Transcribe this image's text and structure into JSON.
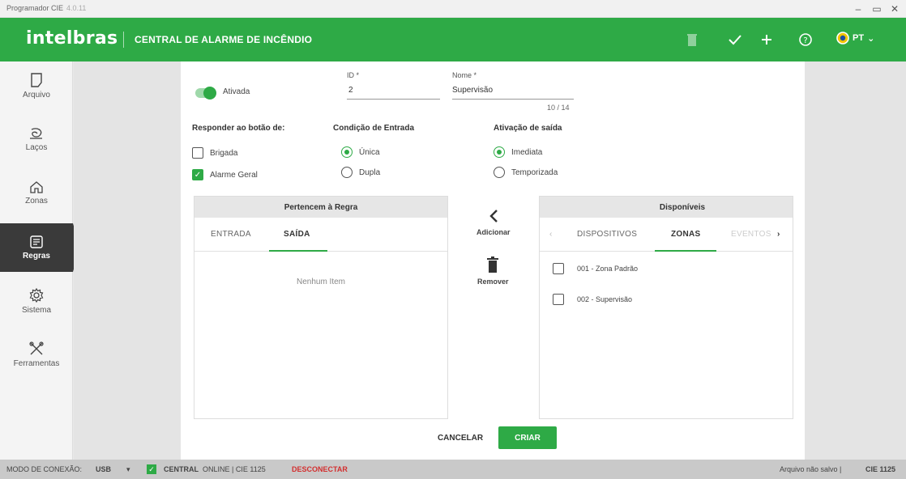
{
  "window": {
    "title": "Programador CIE",
    "version": "4.0.11"
  },
  "header": {
    "brand": "intelbras",
    "title": "CENTRAL DE ALARME DE INCÊNDIO",
    "lang": "PT"
  },
  "sidebar": {
    "items": [
      {
        "label": "Arquivo",
        "icon": "file-icon"
      },
      {
        "label": "Laços",
        "icon": "loop-icon"
      },
      {
        "label": "Zonas",
        "icon": "home-icon"
      },
      {
        "label": "Regras",
        "icon": "rules-icon",
        "active": true
      },
      {
        "label": "Sistema",
        "icon": "gear-icon"
      },
      {
        "label": "Ferramentas",
        "icon": "tools-icon"
      }
    ]
  },
  "form": {
    "toggle_label": "Ativada",
    "id_label": "ID *",
    "id_value": "2",
    "name_label": "Nome *",
    "name_value": "Supervisão",
    "counter": "10 / 14",
    "respond_title": "Responder ao botão de:",
    "respond_options": [
      {
        "label": "Brigada",
        "checked": false
      },
      {
        "label": "Alarme Geral",
        "checked": true
      }
    ],
    "entry_title": "Condição de Entrada",
    "entry_options": [
      {
        "label": "Única",
        "checked": true
      },
      {
        "label": "Dupla",
        "checked": false
      }
    ],
    "exit_title": "Ativação de saída",
    "exit_options": [
      {
        "label": "Imediata",
        "checked": true
      },
      {
        "label": "Temporizada",
        "checked": false
      }
    ]
  },
  "left_panel": {
    "title": "Pertencem à Regra",
    "tabs": [
      "ENTRADA",
      "SAÍDA"
    ],
    "active_tab": "SAÍDA",
    "empty": "Nenhum Item"
  },
  "middle": {
    "add_label": "Adicionar",
    "remove_label": "Remover"
  },
  "right_panel": {
    "title": "Disponíveis",
    "tabs": [
      "DISPOSITIVOS",
      "ZONAS",
      "EVENTOS"
    ],
    "active_tab": "ZONAS",
    "items": [
      "001 - Zona Padrão",
      "002 - Supervisão"
    ]
  },
  "buttons": {
    "cancel": "CANCELAR",
    "create": "CRIAR"
  },
  "statusbar": {
    "mode_label": "MODO DE CONEXÃO:",
    "mode_value": "USB",
    "central_status": "CENTRAL",
    "online": "ONLINE | CIE 1125",
    "disconnect": "DESCONECTAR",
    "right": "Arquivo não salvo |",
    "right_model": "CIE 1125"
  },
  "colors": {
    "brand": "#2eaa46",
    "danger": "#d32f2f"
  }
}
